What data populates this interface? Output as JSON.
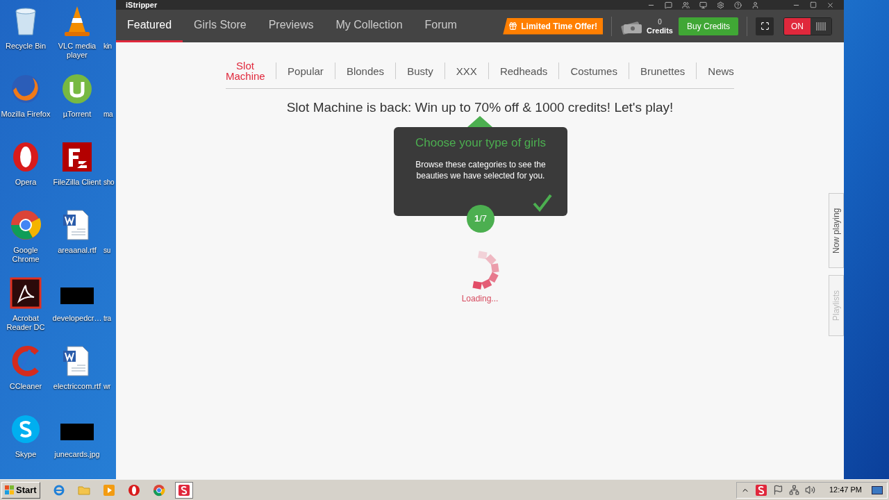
{
  "desktop": {
    "icons": [
      {
        "label": "Recycle Bin",
        "kind": "recycle"
      },
      {
        "label": "VLC media player",
        "kind": "vlc"
      },
      {
        "label": "Mozilla Firefox",
        "kind": "firefox"
      },
      {
        "label": "µTorrent",
        "kind": "utorrent"
      },
      {
        "label": "Opera",
        "kind": "opera"
      },
      {
        "label": "FileZilla Client",
        "kind": "filezilla"
      },
      {
        "label": "Google Chrome",
        "kind": "chrome"
      },
      {
        "label": "areaanal.rtf",
        "kind": "document"
      },
      {
        "label": "Acrobat Reader DC",
        "kind": "acrobat"
      },
      {
        "label": "developedcr…",
        "kind": "redacted"
      },
      {
        "label": "CCleaner",
        "kind": "ccleaner"
      },
      {
        "label": "electriccom.rtf",
        "kind": "document"
      },
      {
        "label": "Skype",
        "kind": "skype"
      },
      {
        "label": "junecards.jpg",
        "kind": "redacted"
      }
    ],
    "partial_labels": [
      "kin",
      "ma",
      "sho",
      "su",
      "tra",
      "wr"
    ]
  },
  "window": {
    "title": "iStripper",
    "nav": [
      {
        "label": "Featured",
        "selected": true
      },
      {
        "label": "Girls Store",
        "selected": false
      },
      {
        "label": "Previews",
        "selected": false
      },
      {
        "label": "My Collection",
        "selected": false
      },
      {
        "label": "Forum",
        "selected": false
      }
    ],
    "offer_button": "Limited Time Offer!",
    "credits": {
      "count": "0",
      "label": "Credits"
    },
    "buy_button": "Buy Credits",
    "toggle": {
      "label": "ON",
      "on": true
    },
    "categories": [
      {
        "label": "Slot Machine",
        "selected": true
      },
      {
        "label": "Popular",
        "selected": false
      },
      {
        "label": "Blondes",
        "selected": false
      },
      {
        "label": "Busty",
        "selected": false
      },
      {
        "label": "XXX",
        "selected": false
      },
      {
        "label": "Redheads",
        "selected": false
      },
      {
        "label": "Costumes",
        "selected": false
      },
      {
        "label": "Brunettes",
        "selected": false
      },
      {
        "label": "News",
        "selected": false
      }
    ],
    "headline": "Slot Machine is back: Win up to 70% off & 1000 credits! Let's play!",
    "tooltip": {
      "title": "Choose your type of girls",
      "body": "Browse these categories to see the beauties we have selected for you.",
      "step": "**1**/7"
    },
    "loading": "Loading...",
    "side_tabs": [
      {
        "label": "Now playing",
        "disabled": false
      },
      {
        "label": "Playlists",
        "disabled": true
      }
    ]
  },
  "taskbar": {
    "start": "Start",
    "apps": [
      {
        "kind": "ie",
        "active": false
      },
      {
        "kind": "folder",
        "active": false
      },
      {
        "kind": "media",
        "active": false
      },
      {
        "kind": "opera",
        "active": false
      },
      {
        "kind": "chrome",
        "active": false
      },
      {
        "kind": "istripper",
        "active": true
      }
    ],
    "clock": "12:47 PM"
  }
}
